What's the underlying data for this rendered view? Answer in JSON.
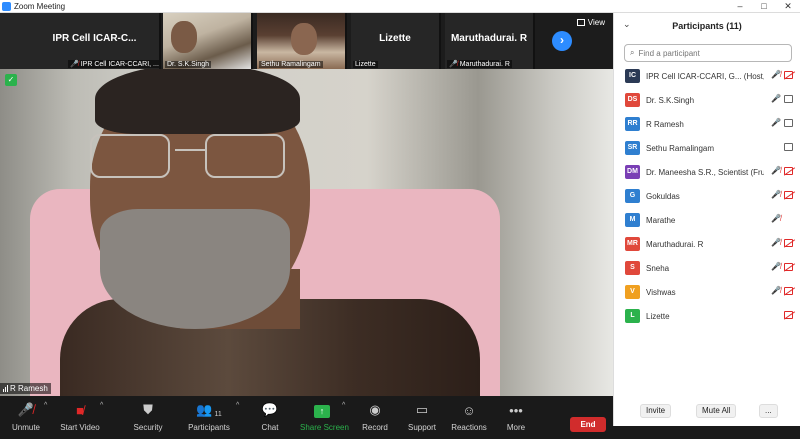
{
  "window": {
    "title": "Zoom Meeting",
    "controls": [
      "–",
      "□",
      "✕"
    ]
  },
  "strip": {
    "tiles": [
      {
        "display": "IPR  Cell ICAR-C...",
        "caption": "IPR Cell ICAR-CCARI, ...",
        "muted": true,
        "video": false
      },
      {
        "display": "",
        "caption": "Dr. S.K.Singh",
        "muted": false,
        "video": true
      },
      {
        "display": "",
        "caption": "Sethu Ramalingam",
        "muted": false,
        "video": true
      },
      {
        "display": "Lizette",
        "caption": "Lizette",
        "muted": false,
        "video": false
      },
      {
        "display": "Maruthadurai. R",
        "caption": "Maruthadurai. R",
        "muted": true,
        "video": false
      }
    ],
    "view_label": "View"
  },
  "main_video": {
    "speaker": "R Ramesh"
  },
  "toolbar": {
    "unmute": "Unmute",
    "start_video": "Start Video",
    "security": "Security",
    "participants": "Participants",
    "participants_count": "11",
    "chat": "Chat",
    "share_screen": "Share Screen",
    "record": "Record",
    "support": "Support",
    "reactions": "Reactions",
    "more": "More",
    "end": "End"
  },
  "panel": {
    "title": "Participants (11)",
    "search_placeholder": "Find a participant",
    "participants": [
      {
        "initials": "IC",
        "name": "IPR Cell ICAR-CCARI, G... (Host, me)",
        "color": "#2b3a55",
        "mic": "red",
        "cam": "red"
      },
      {
        "initials": "DS",
        "name": "Dr. S.K.Singh",
        "color": "#e0483b",
        "mic": "gray",
        "cam": "gray"
      },
      {
        "initials": "RR",
        "name": "R Ramesh",
        "color": "#2f7fd0",
        "mic": "gray",
        "cam": "gray"
      },
      {
        "initials": "SR",
        "name": "Sethu Ramalingam",
        "color": "#2f7fd0",
        "mic": "none",
        "cam": "gray"
      },
      {
        "initials": "DM",
        "name": "Dr. Maneesha S.R., Scientist (Fruit...",
        "color": "#7a3fb5",
        "mic": "red",
        "cam": "red"
      },
      {
        "initials": "G",
        "name": "Gokuldas",
        "color": "#2f7fd0",
        "mic": "red",
        "cam": "red"
      },
      {
        "initials": "M",
        "name": "Marathe",
        "color": "#2f7fd0",
        "mic": "red",
        "cam": "none"
      },
      {
        "initials": "MR",
        "name": "Maruthadurai. R",
        "color": "#e0483b",
        "mic": "red",
        "cam": "red"
      },
      {
        "initials": "S",
        "name": "Sneha",
        "color": "#e0483b",
        "mic": "red",
        "cam": "red"
      },
      {
        "initials": "V",
        "name": "Vishwas",
        "color": "#f0a020",
        "mic": "red",
        "cam": "red"
      },
      {
        "initials": "L",
        "name": "Lizette",
        "color": "#2bb24c",
        "mic": "none",
        "cam": "red"
      }
    ],
    "invite": "Invite",
    "mute_all": "Mute All",
    "more": "..."
  }
}
